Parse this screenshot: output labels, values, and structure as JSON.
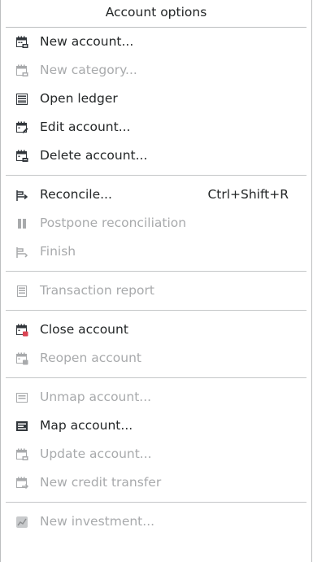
{
  "menu": {
    "title": "Account options",
    "items": {
      "new_account": {
        "label": "New account...",
        "enabled": true,
        "icon": "calendar-add-icon"
      },
      "new_category": {
        "label": "New category...",
        "enabled": false,
        "icon": "calendar-add-icon"
      },
      "open_ledger": {
        "label": "Open ledger",
        "enabled": true,
        "icon": "ledger-icon"
      },
      "edit_account": {
        "label": "Edit account...",
        "enabled": true,
        "icon": "calendar-edit-icon"
      },
      "delete_account": {
        "label": "Delete account...",
        "enabled": true,
        "icon": "calendar-delete-icon"
      },
      "reconcile": {
        "label": "Reconcile...",
        "shortcut": "Ctrl+Shift+R",
        "enabled": true,
        "icon": "reconcile-icon"
      },
      "postpone_reconciliation": {
        "label": "Postpone reconciliation",
        "enabled": false,
        "icon": "pause-icon"
      },
      "finish": {
        "label": "Finish",
        "enabled": false,
        "icon": "finish-icon"
      },
      "transaction_report": {
        "label": "Transaction report",
        "enabled": false,
        "icon": "report-icon"
      },
      "close_account": {
        "label": "Close account",
        "enabled": true,
        "icon": "calendar-close-icon"
      },
      "reopen_account": {
        "label": "Reopen account",
        "enabled": false,
        "icon": "calendar-reopen-icon"
      },
      "unmap_account": {
        "label": "Unmap account...",
        "enabled": false,
        "icon": "unmap-icon"
      },
      "map_account": {
        "label": "Map account...",
        "enabled": true,
        "icon": "map-icon"
      },
      "update_account": {
        "label": "Update account...",
        "enabled": false,
        "icon": "calendar-update-icon"
      },
      "new_credit_transfer": {
        "label": "New credit transfer",
        "enabled": false,
        "icon": "calendar-transfer-icon"
      },
      "new_investment": {
        "label": "New investment...",
        "enabled": false,
        "icon": "investment-icon"
      }
    }
  },
  "colors": {
    "enabled_text": "#232627",
    "disabled_text": "#a8aaac",
    "separator": "#c4c6c8",
    "background": "#ffffff"
  }
}
